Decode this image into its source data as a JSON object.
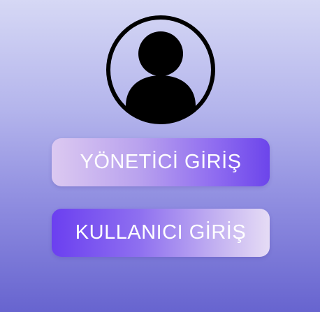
{
  "avatar": {
    "icon": "user-avatar-icon"
  },
  "buttons": {
    "admin_login": "YÖNETİCİ GİRİŞ",
    "user_login": "KULLANICI GİRİŞ"
  },
  "colors": {
    "background_top": "#d6d8f5",
    "background_bottom": "#6764cf",
    "button_accent": "#6c45eb",
    "button_light": "#dcc9f1",
    "icon": "#000000"
  }
}
